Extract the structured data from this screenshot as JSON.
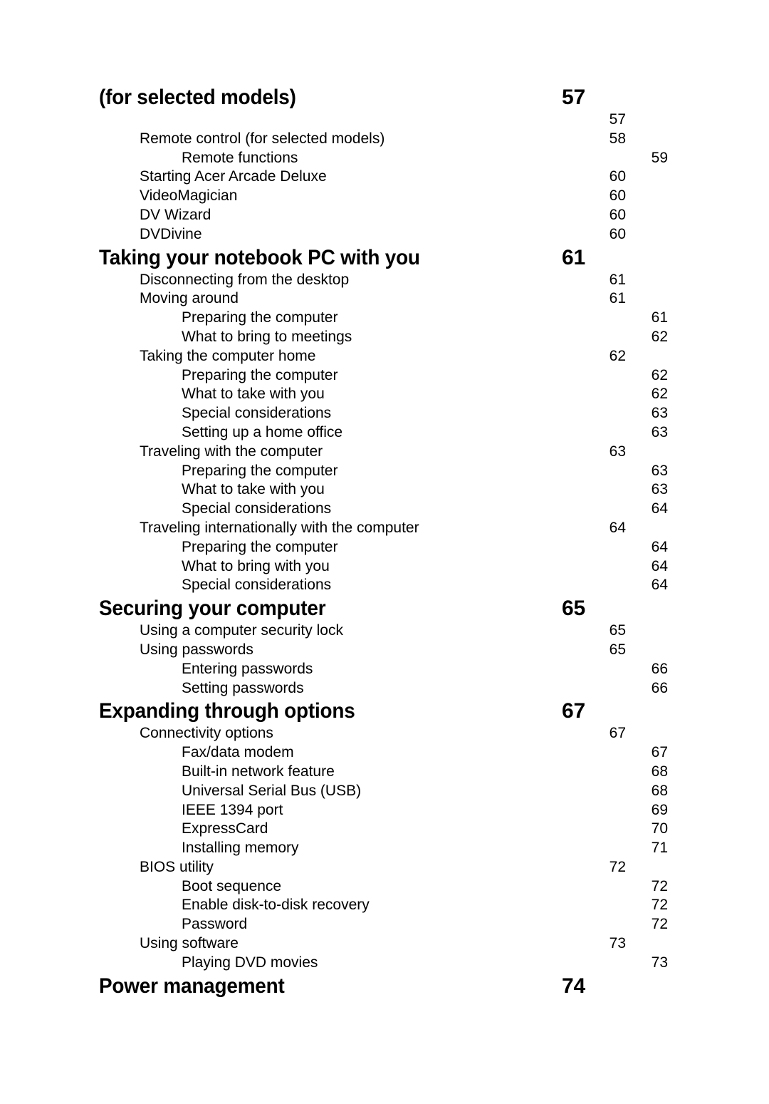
{
  "document": {
    "type": "table-of-contents",
    "page_background": "#ffffff",
    "text_color": "#000000"
  },
  "toc": {
    "entries": [
      {
        "level": "heading",
        "label": "(for selected models)",
        "page": "57"
      },
      {
        "level": 1,
        "label": "",
        "page": "57"
      },
      {
        "level": 1,
        "label": "Remote control (for selected models)",
        "page": "58"
      },
      {
        "level": 2,
        "label": "Remote functions",
        "page": "59"
      },
      {
        "level": 1,
        "label": "Starting Acer Arcade Deluxe",
        "page": "60"
      },
      {
        "level": 1,
        "label": "VideoMagician",
        "page": "60"
      },
      {
        "level": 1,
        "label": "DV Wizard",
        "page": "60"
      },
      {
        "level": 1,
        "label": "DVDivine",
        "page": "60"
      },
      {
        "level": "heading",
        "label": "Taking your notebook PC with you",
        "page": "61"
      },
      {
        "level": 1,
        "label": "Disconnecting from the desktop",
        "page": "61"
      },
      {
        "level": 1,
        "label": "Moving around",
        "page": "61"
      },
      {
        "level": 2,
        "label": "Preparing the computer",
        "page": "61"
      },
      {
        "level": 2,
        "label": "What to bring to meetings",
        "page": "62"
      },
      {
        "level": 1,
        "label": "Taking the computer home",
        "page": "62"
      },
      {
        "level": 2,
        "label": "Preparing the computer",
        "page": "62"
      },
      {
        "level": 2,
        "label": "What to take with you",
        "page": "62"
      },
      {
        "level": 2,
        "label": "Special considerations",
        "page": "63"
      },
      {
        "level": 2,
        "label": "Setting up a home office",
        "page": "63"
      },
      {
        "level": 1,
        "label": "Traveling with the computer",
        "page": "63"
      },
      {
        "level": 2,
        "label": "Preparing the computer",
        "page": "63"
      },
      {
        "level": 2,
        "label": "What to take with you",
        "page": "63"
      },
      {
        "level": 2,
        "label": "Special considerations",
        "page": "64"
      },
      {
        "level": 1,
        "label": "Traveling internationally with the computer",
        "page": "64"
      },
      {
        "level": 2,
        "label": "Preparing the computer",
        "page": "64"
      },
      {
        "level": 2,
        "label": "What to bring with you",
        "page": "64"
      },
      {
        "level": 2,
        "label": "Special considerations",
        "page": "64"
      },
      {
        "level": "heading",
        "label": "Securing your computer",
        "page": "65"
      },
      {
        "level": 1,
        "label": "Using a computer security lock",
        "page": "65"
      },
      {
        "level": 1,
        "label": "Using passwords",
        "page": "65"
      },
      {
        "level": 2,
        "label": "Entering passwords",
        "page": "66"
      },
      {
        "level": 2,
        "label": "Setting passwords",
        "page": "66"
      },
      {
        "level": "heading",
        "label": "Expanding through options",
        "page": "67"
      },
      {
        "level": 1,
        "label": "Connectivity options",
        "page": "67"
      },
      {
        "level": 2,
        "label": "Fax/data modem",
        "page": "67"
      },
      {
        "level": 2,
        "label": "Built-in network feature",
        "page": "68"
      },
      {
        "level": 2,
        "label": "Universal Serial Bus (USB)",
        "page": "68"
      },
      {
        "level": 2,
        "label": "IEEE 1394 port",
        "page": "69"
      },
      {
        "level": 2,
        "label": "ExpressCard",
        "page": "70"
      },
      {
        "level": 2,
        "label": "Installing memory",
        "page": "71"
      },
      {
        "level": 1,
        "label": "BIOS utility",
        "page": "72"
      },
      {
        "level": 2,
        "label": "Boot sequence",
        "page": "72"
      },
      {
        "level": 2,
        "label": "Enable disk-to-disk recovery",
        "page": "72"
      },
      {
        "level": 2,
        "label": "Password",
        "page": "72"
      },
      {
        "level": 1,
        "label": "Using software",
        "page": "73"
      },
      {
        "level": 2,
        "label": "Playing DVD movies",
        "page": "73"
      },
      {
        "level": "heading",
        "label": "Power management",
        "page": "74"
      }
    ]
  }
}
